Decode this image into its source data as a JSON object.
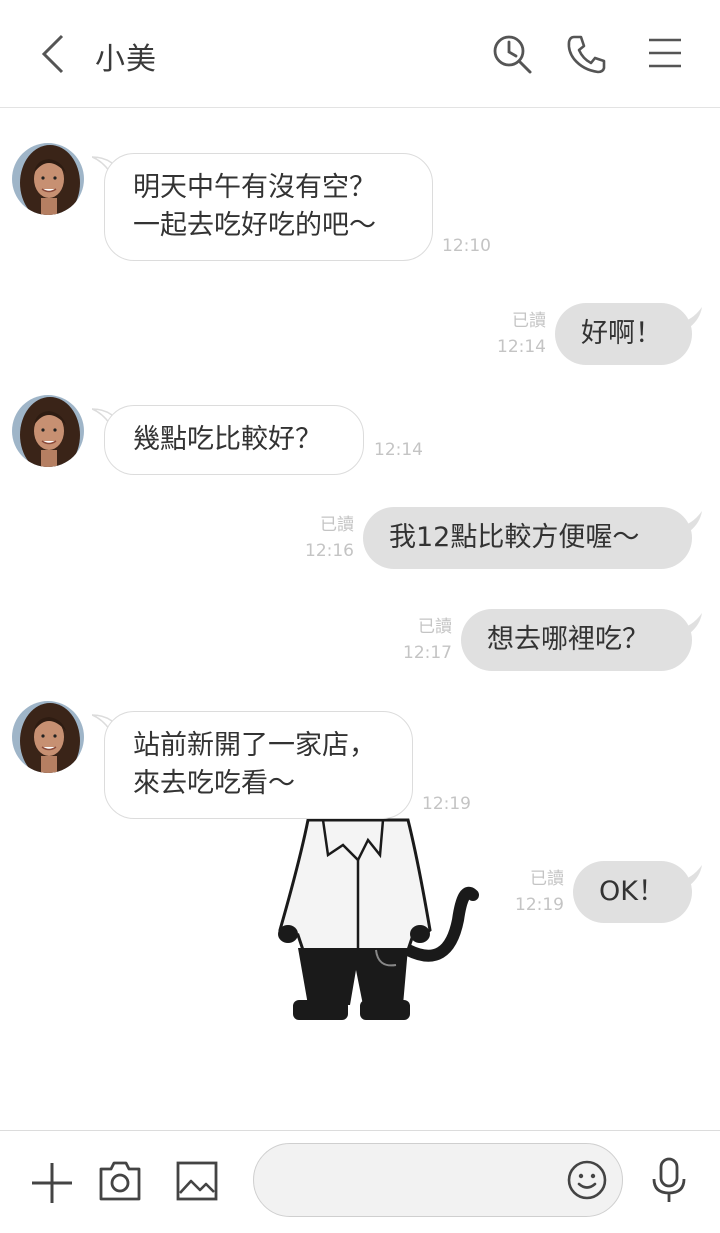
{
  "header": {
    "title": "小美"
  },
  "messages": [
    {
      "direction": "incoming",
      "lines": [
        "明天中午有沒有空？",
        "一起去吃好吃的吧～"
      ],
      "time": "12:10"
    },
    {
      "direction": "outgoing",
      "lines": [
        "好啊！"
      ],
      "read": "已讀",
      "time": "12:14"
    },
    {
      "direction": "incoming",
      "lines": [
        "幾點吃比較好？"
      ],
      "time": "12:14"
    },
    {
      "direction": "outgoing",
      "lines": [
        "我12點比較方便喔～"
      ],
      "read": "已讀",
      "time": "12:16"
    },
    {
      "direction": "outgoing",
      "lines": [
        "想去哪裡吃？"
      ],
      "read": "已讀",
      "time": "12:17"
    },
    {
      "direction": "incoming",
      "lines": [
        "站前新開了一家店，",
        "來去吃吃看～"
      ],
      "time": "12:19"
    },
    {
      "direction": "outgoing",
      "lines": [
        "OK！"
      ],
      "read": "已讀",
      "time": "12:19"
    }
  ],
  "sticker": {
    "icon": "cat-in-jacket-sticker"
  },
  "composer": {
    "input_value": "",
    "icons": [
      "plus-icon",
      "camera-icon",
      "image-icon",
      "smiley-icon",
      "microphone-icon"
    ]
  }
}
